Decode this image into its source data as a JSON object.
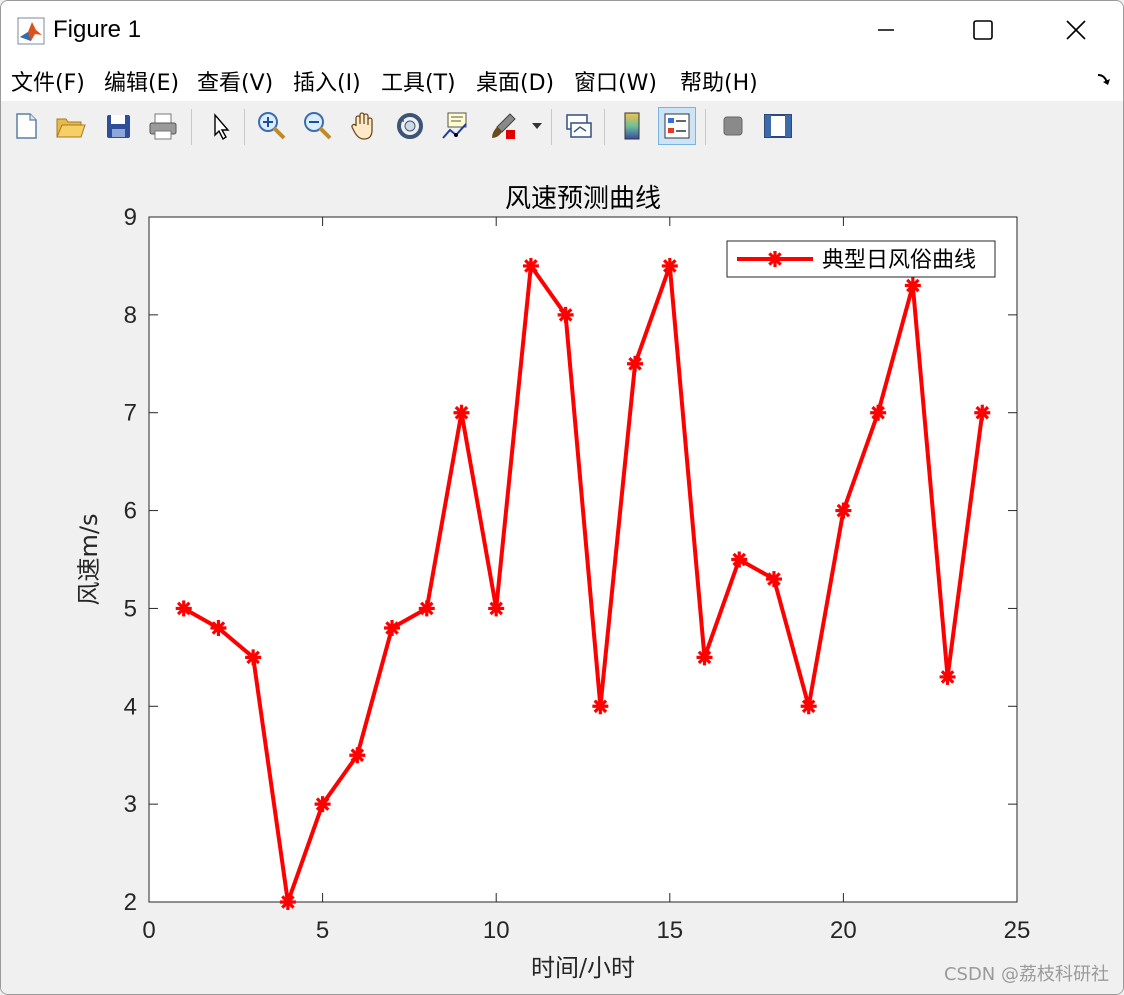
{
  "window": {
    "title": "Figure 1"
  },
  "menu": [
    {
      "label": "文件(F)"
    },
    {
      "label": "编辑(E)"
    },
    {
      "label": "查看(V)"
    },
    {
      "label": "插入(I)"
    },
    {
      "label": "工具(T)"
    },
    {
      "label": "桌面(D)"
    },
    {
      "label": "窗口(W)"
    },
    {
      "label": "帮助(H)"
    }
  ],
  "toolbar": {
    "icons": [
      "new-figure-icon",
      "open-icon",
      "save-icon",
      "print-icon",
      "select-arrow-icon",
      "zoom-in-icon",
      "zoom-out-icon",
      "pan-hand-icon",
      "rotate-3d-icon",
      "data-cursor-icon",
      "brush-icon",
      "brush-dropdown-icon",
      "link-plot-icon",
      "colorbar-icon",
      "legend-icon",
      "hide-plot-tools-icon",
      "show-plot-tools-icon"
    ]
  },
  "colors": {
    "line": "#ff0000",
    "axes_bg": "#ffffff",
    "figure_bg": "#f0f0f0"
  },
  "watermark": "CSDN @荔枝科研社",
  "chart_data": {
    "type": "line",
    "title": "风速预测曲线",
    "xlabel": "时间/小时",
    "ylabel": "风速m/s",
    "xlim": [
      0,
      25
    ],
    "ylim": [
      2,
      9
    ],
    "xticks": [
      "0",
      "5",
      "10",
      "15",
      "20",
      "25"
    ],
    "yticks": [
      "2",
      "3",
      "4",
      "5",
      "6",
      "7",
      "8",
      "9"
    ],
    "legend_position": "top-right",
    "grid": false,
    "series": [
      {
        "name": "典型日风俗曲线",
        "marker": "star",
        "x": [
          1,
          2,
          3,
          4,
          5,
          6,
          7,
          8,
          9,
          10,
          11,
          12,
          13,
          14,
          15,
          16,
          17,
          18,
          19,
          20,
          21,
          22,
          23,
          24
        ],
        "values": [
          5.0,
          4.8,
          4.5,
          2.0,
          3.0,
          3.5,
          4.8,
          5.0,
          7.0,
          5.0,
          8.5,
          8.0,
          4.0,
          7.5,
          8.5,
          4.5,
          5.5,
          5.3,
          4.0,
          6.0,
          7.0,
          8.3,
          4.3,
          7.0
        ]
      }
    ]
  }
}
